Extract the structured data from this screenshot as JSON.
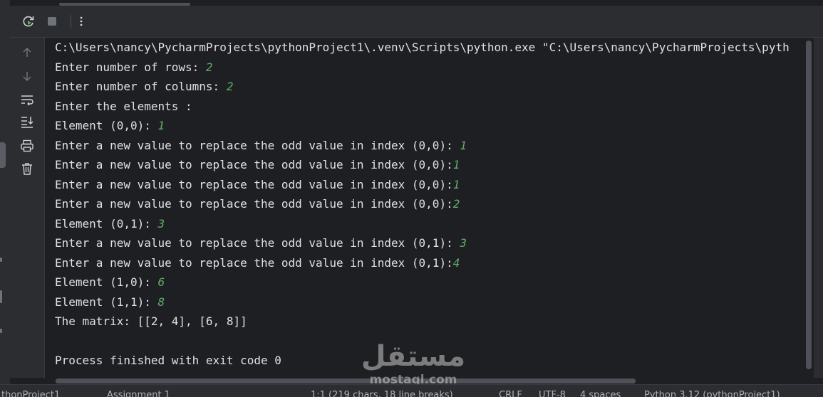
{
  "toolbar": {
    "rerun_icon": "rerun-icon",
    "stop_icon": "stop-icon",
    "more_icon": "more-options-icon"
  },
  "gutter": {
    "icons": [
      "arrow-up-icon",
      "arrow-down-icon",
      "soft-wrap-icon",
      "scroll-to-end-icon",
      "print-icon",
      "trash-icon"
    ]
  },
  "console": {
    "command": "C:\\Users\\nancy\\PycharmProjects\\pythonProject1\\.venv\\Scripts\\python.exe \"C:\\Users\\nancy\\PycharmProjects\\pyth",
    "lines": [
      {
        "prompt": "Enter number of rows: ",
        "input": "2"
      },
      {
        "prompt": "Enter number of columns: ",
        "input": "2"
      },
      {
        "prompt": "Enter the elements :",
        "input": ""
      },
      {
        "prompt": "Element (0,0): ",
        "input": "1"
      },
      {
        "prompt": "Enter a new value to replace the odd value in index (0,0): ",
        "input": "1"
      },
      {
        "prompt": "Enter a new value to replace the odd value in index (0,0):",
        "input": "1"
      },
      {
        "prompt": "Enter a new value to replace the odd value in index (0,0):",
        "input": "1"
      },
      {
        "prompt": "Enter a new value to replace the odd value in index (0,0):",
        "input": "2"
      },
      {
        "prompt": "Element (0,1): ",
        "input": "3"
      },
      {
        "prompt": "Enter a new value to replace the odd value in index (0,1): ",
        "input": "3"
      },
      {
        "prompt": "Enter a new value to replace the odd value in index (0,1):",
        "input": "4"
      },
      {
        "prompt": "Element (1,0): ",
        "input": "6"
      },
      {
        "prompt": "Element (1,1): ",
        "input": "8"
      },
      {
        "prompt": "The matrix: [[2, 4], [6, 8]]",
        "input": ""
      }
    ],
    "exit_message": "Process finished with exit code 0"
  },
  "watermark": {
    "arabic": "مستقل",
    "latin": "mostaql.com"
  },
  "statusbar": {
    "project": "thonProject1",
    "file": "Assignment 1",
    "position": "1:1 (219 chars, 18 line breaks)",
    "line_sep": "CRLF",
    "encoding": "UTF-8",
    "indent": "4 spaces",
    "interpreter": "Python 3.12 (pythonProject1)"
  },
  "colors": {
    "background": "#1e1f22",
    "panel": "#2b2d30",
    "text": "#dfe1e5",
    "user_input": "#5fad65"
  }
}
